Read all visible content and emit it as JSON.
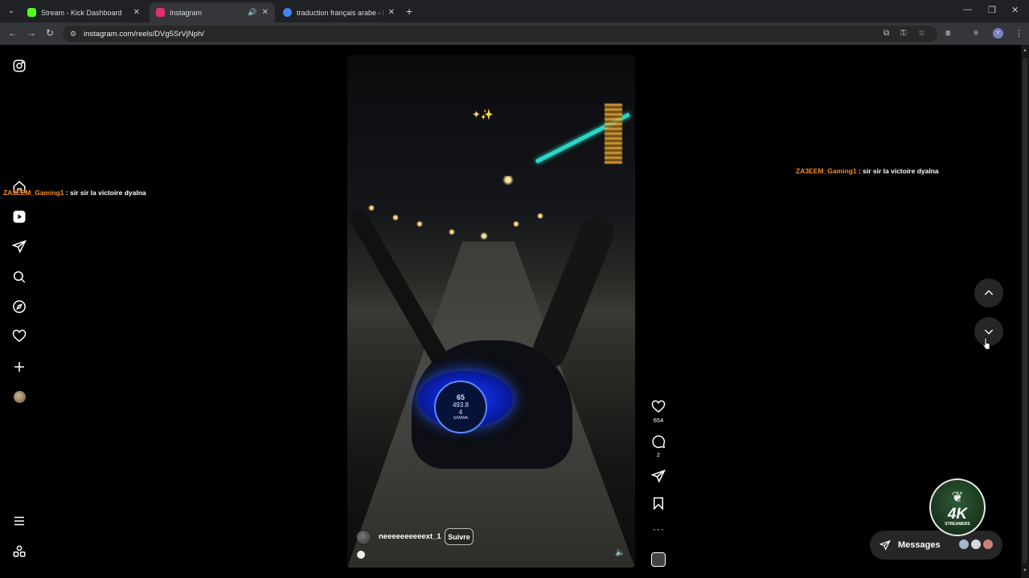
{
  "browser": {
    "tabs": [
      {
        "title": "Stream - Kick Dashboard",
        "favicon_color": "#53fc18",
        "active": false
      },
      {
        "title": "Instagram",
        "favicon_color": "#e1306c",
        "active": true
      },
      {
        "title": "traduction français arabe - Rec",
        "favicon_color": "#4285f4",
        "active": false
      }
    ],
    "url": "instagram.com/reels/DVg5SrVjNph/",
    "profile_initial": "Y"
  },
  "sidebar": {
    "items": [
      {
        "icon": "instagram-logo-icon"
      },
      {
        "icon": "home-icon"
      },
      {
        "icon": "reels-icon"
      },
      {
        "icon": "direct-messages-icon"
      },
      {
        "icon": "search-icon"
      },
      {
        "icon": "explore-icon"
      },
      {
        "icon": "notifications-heart-icon"
      },
      {
        "icon": "create-plus-icon"
      },
      {
        "icon": "profile-avatar"
      },
      {
        "icon": "more-menu-icon"
      },
      {
        "icon": "also-from-meta-icon"
      }
    ]
  },
  "stream_overlay": {
    "chat_left": {
      "user": "ZA3EEM_Gaming1",
      "message": " : sir sir la victoire dyalna"
    },
    "chat_right": {
      "user": "ZA3EEM_Gaming1",
      "message": " : sir sir la victoire dyalna"
    },
    "badge_main": "4K",
    "badge_sub": "STREAMERS"
  },
  "reel": {
    "username": "neeeeeeeeeext_1",
    "follow_label": "Suivre",
    "likes": "654",
    "comments": "2",
    "speedometer": {
      "speed": "65",
      "odometer": "493.8",
      "gear": "4",
      "brand": "SANWA"
    }
  },
  "messages": {
    "label": "Messages"
  },
  "colors": {
    "chat_user": "#ff8c1a",
    "background": "#000000",
    "accent_teal": "#27d8c8"
  }
}
